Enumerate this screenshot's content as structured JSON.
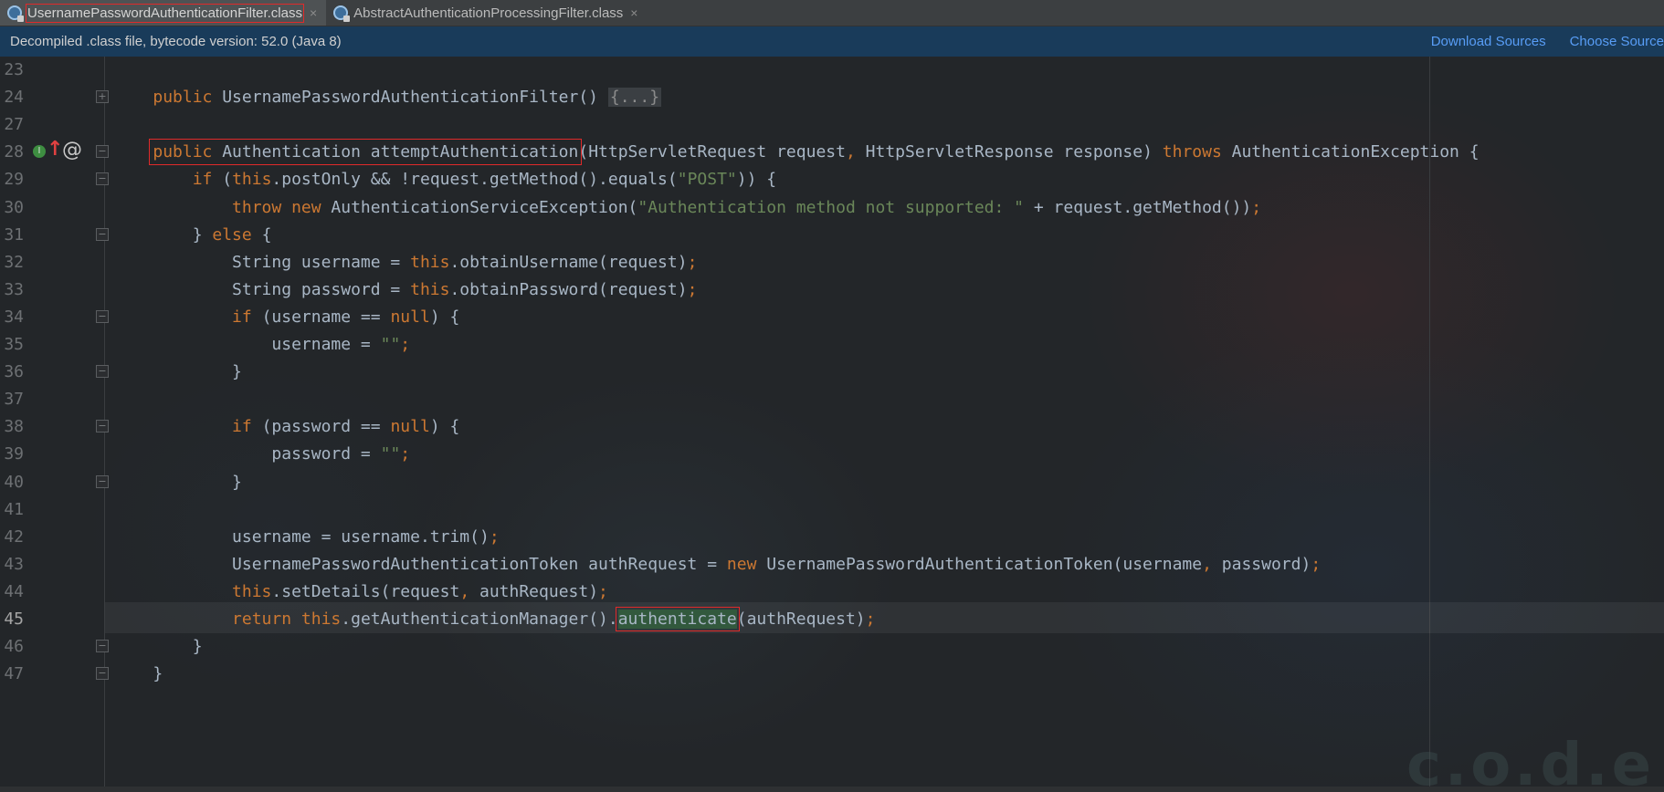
{
  "tabs": [
    {
      "label": "UsernamePasswordAuthenticationFilter.class",
      "close": "×",
      "active": true
    },
    {
      "label": "AbstractAuthenticationProcessingFilter.class",
      "close": "×",
      "active": false
    }
  ],
  "infobar": {
    "message": "Decompiled .class file, bytecode version: 52.0 (Java 8)",
    "download_sources": "Download Sources",
    "choose_sources": "Choose Sources..."
  },
  "gutter_icons": {
    "implements": "I",
    "overrides": "↑",
    "annotation": "@"
  },
  "lines": [
    {
      "n": "23",
      "tokens": []
    },
    {
      "n": "24",
      "tokens": [
        {
          "t": "    "
        },
        {
          "t": "public ",
          "c": "kw"
        },
        {
          "t": "UsernamePasswordAuthenticationFilter() "
        },
        {
          "t": "{...}",
          "c": "folded"
        }
      ]
    },
    {
      "n": "27",
      "tokens": []
    },
    {
      "n": "28",
      "tokens": [
        {
          "t": "    "
        },
        {
          "t": "public ",
          "c": "kw",
          "box": "start"
        },
        {
          "t": "Authentication attemptAuthentication",
          "box": "end"
        },
        {
          "t": "(HttpServletRequest request"
        },
        {
          "t": ", ",
          "c": "kw"
        },
        {
          "t": "HttpServletResponse response) "
        },
        {
          "t": "throws ",
          "c": "kw"
        },
        {
          "t": "AuthenticationException {"
        }
      ]
    },
    {
      "n": "29",
      "tokens": [
        {
          "t": "        "
        },
        {
          "t": "if ",
          "c": "kw"
        },
        {
          "t": "("
        },
        {
          "t": "this",
          "c": "kw"
        },
        {
          "t": ".postOnly && !request.getMethod().equals("
        },
        {
          "t": "\"POST\"",
          "c": "str"
        },
        {
          "t": ")) {"
        }
      ]
    },
    {
      "n": "30",
      "tokens": [
        {
          "t": "            "
        },
        {
          "t": "throw new ",
          "c": "kw"
        },
        {
          "t": "AuthenticationServiceException("
        },
        {
          "t": "\"Authentication method not supported: \"",
          "c": "str"
        },
        {
          "t": " + request.getMethod())"
        },
        {
          "t": ";",
          "c": "kw"
        }
      ]
    },
    {
      "n": "31",
      "tokens": [
        {
          "t": "        } "
        },
        {
          "t": "else ",
          "c": "kw"
        },
        {
          "t": "{"
        }
      ]
    },
    {
      "n": "32",
      "tokens": [
        {
          "t": "            String username = "
        },
        {
          "t": "this",
          "c": "kw"
        },
        {
          "t": ".obtainUsername(request)"
        },
        {
          "t": ";",
          "c": "kw"
        }
      ]
    },
    {
      "n": "33",
      "tokens": [
        {
          "t": "            String password = "
        },
        {
          "t": "this",
          "c": "kw"
        },
        {
          "t": ".obtainPassword(request)"
        },
        {
          "t": ";",
          "c": "kw"
        }
      ]
    },
    {
      "n": "34",
      "tokens": [
        {
          "t": "            "
        },
        {
          "t": "if ",
          "c": "kw"
        },
        {
          "t": "(username == "
        },
        {
          "t": "null",
          "c": "kw"
        },
        {
          "t": ") {"
        }
      ]
    },
    {
      "n": "35",
      "tokens": [
        {
          "t": "                username = "
        },
        {
          "t": "\"\"",
          "c": "str"
        },
        {
          "t": ";",
          "c": "kw"
        }
      ]
    },
    {
      "n": "36",
      "tokens": [
        {
          "t": "            }"
        }
      ]
    },
    {
      "n": "37",
      "tokens": []
    },
    {
      "n": "38",
      "tokens": [
        {
          "t": "            "
        },
        {
          "t": "if ",
          "c": "kw"
        },
        {
          "t": "(password == "
        },
        {
          "t": "null",
          "c": "kw"
        },
        {
          "t": ") {"
        }
      ]
    },
    {
      "n": "39",
      "tokens": [
        {
          "t": "                password = "
        },
        {
          "t": "\"\"",
          "c": "str"
        },
        {
          "t": ";",
          "c": "kw"
        }
      ]
    },
    {
      "n": "40",
      "tokens": [
        {
          "t": "            }"
        }
      ]
    },
    {
      "n": "41",
      "tokens": []
    },
    {
      "n": "42",
      "tokens": [
        {
          "t": "            username = username.trim()"
        },
        {
          "t": ";",
          "c": "kw"
        }
      ]
    },
    {
      "n": "43",
      "tokens": [
        {
          "t": "            UsernamePasswordAuthenticationToken authRequest = "
        },
        {
          "t": "new ",
          "c": "kw"
        },
        {
          "t": "UsernamePasswordAuthenticationToken(username"
        },
        {
          "t": ", ",
          "c": "kw"
        },
        {
          "t": "password)"
        },
        {
          "t": ";",
          "c": "kw"
        }
      ]
    },
    {
      "n": "44",
      "tokens": [
        {
          "t": "            "
        },
        {
          "t": "this",
          "c": "kw"
        },
        {
          "t": ".setDetails(request"
        },
        {
          "t": ", ",
          "c": "kw"
        },
        {
          "t": "authRequest)"
        },
        {
          "t": ";",
          "c": "kw"
        }
      ]
    },
    {
      "n": "45",
      "current": true,
      "tokens": [
        {
          "t": "            "
        },
        {
          "t": "return this",
          "c": "kw"
        },
        {
          "t": ".getAuthenticationManager()."
        },
        {
          "t": "authenticate",
          "box": "hl"
        },
        {
          "t": "(authRequest)"
        },
        {
          "t": ";",
          "c": "kw"
        }
      ]
    },
    {
      "n": "46",
      "tokens": [
        {
          "t": "        }"
        }
      ]
    },
    {
      "n": "47",
      "tokens": [
        {
          "t": "    }"
        }
      ]
    }
  ]
}
